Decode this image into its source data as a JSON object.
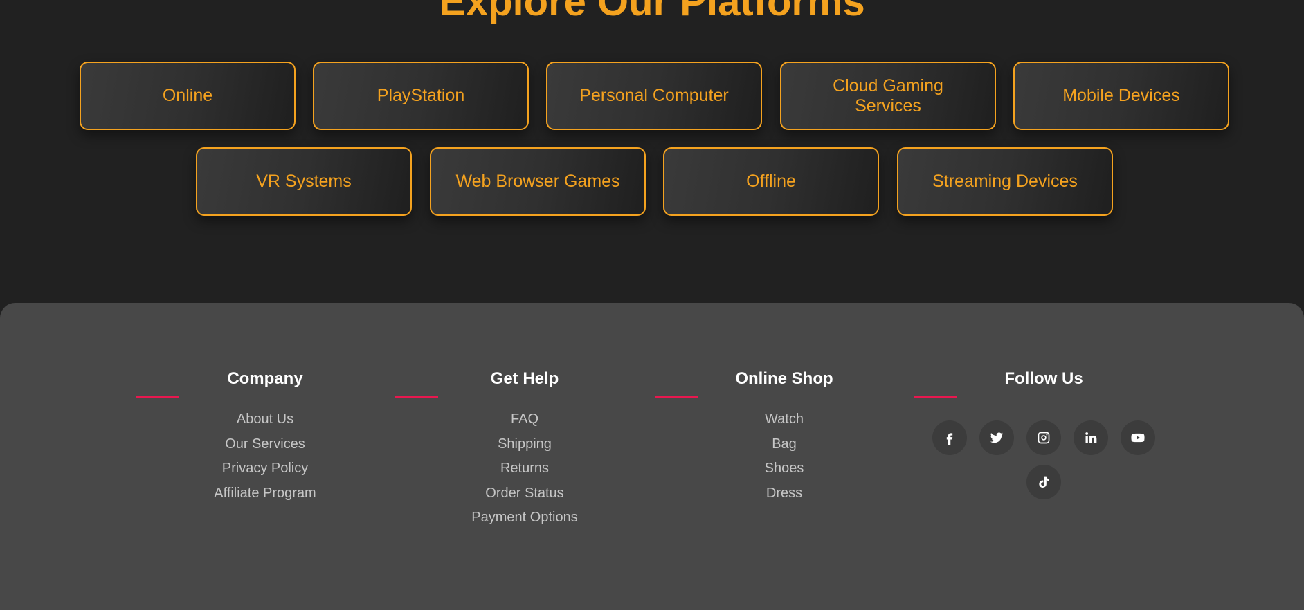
{
  "platforms": {
    "title": "Explore Our Platforms",
    "buttons": [
      {
        "label": "Online"
      },
      {
        "label": "PlayStation"
      },
      {
        "label": "Personal Computer"
      },
      {
        "label": "Cloud Gaming Services"
      },
      {
        "label": "Mobile Devices"
      },
      {
        "label": "VR Systems"
      },
      {
        "label": "Web Browser Games"
      },
      {
        "label": "Offline"
      },
      {
        "label": "Streaming Devices"
      }
    ]
  },
  "footer": {
    "columns": [
      {
        "title": "Company",
        "links": [
          "About Us",
          "Our Services",
          "Privacy Policy",
          "Affiliate Program"
        ]
      },
      {
        "title": "Get Help",
        "links": [
          "FAQ",
          "Shipping",
          "Returns",
          "Order Status",
          "Payment Options"
        ]
      },
      {
        "title": "Online Shop",
        "links": [
          "Watch",
          "Bag",
          "Shoes",
          "Dress"
        ]
      },
      {
        "title": "Follow Us"
      }
    ],
    "socials": [
      "facebook-icon",
      "twitter-icon",
      "instagram-icon",
      "linkedin-icon",
      "youtube-icon",
      "tiktok-icon"
    ]
  },
  "colors": {
    "accent": "#f4a21f",
    "underline": "#e8174f",
    "page_background": "#212121",
    "footer_background": "#484848"
  }
}
